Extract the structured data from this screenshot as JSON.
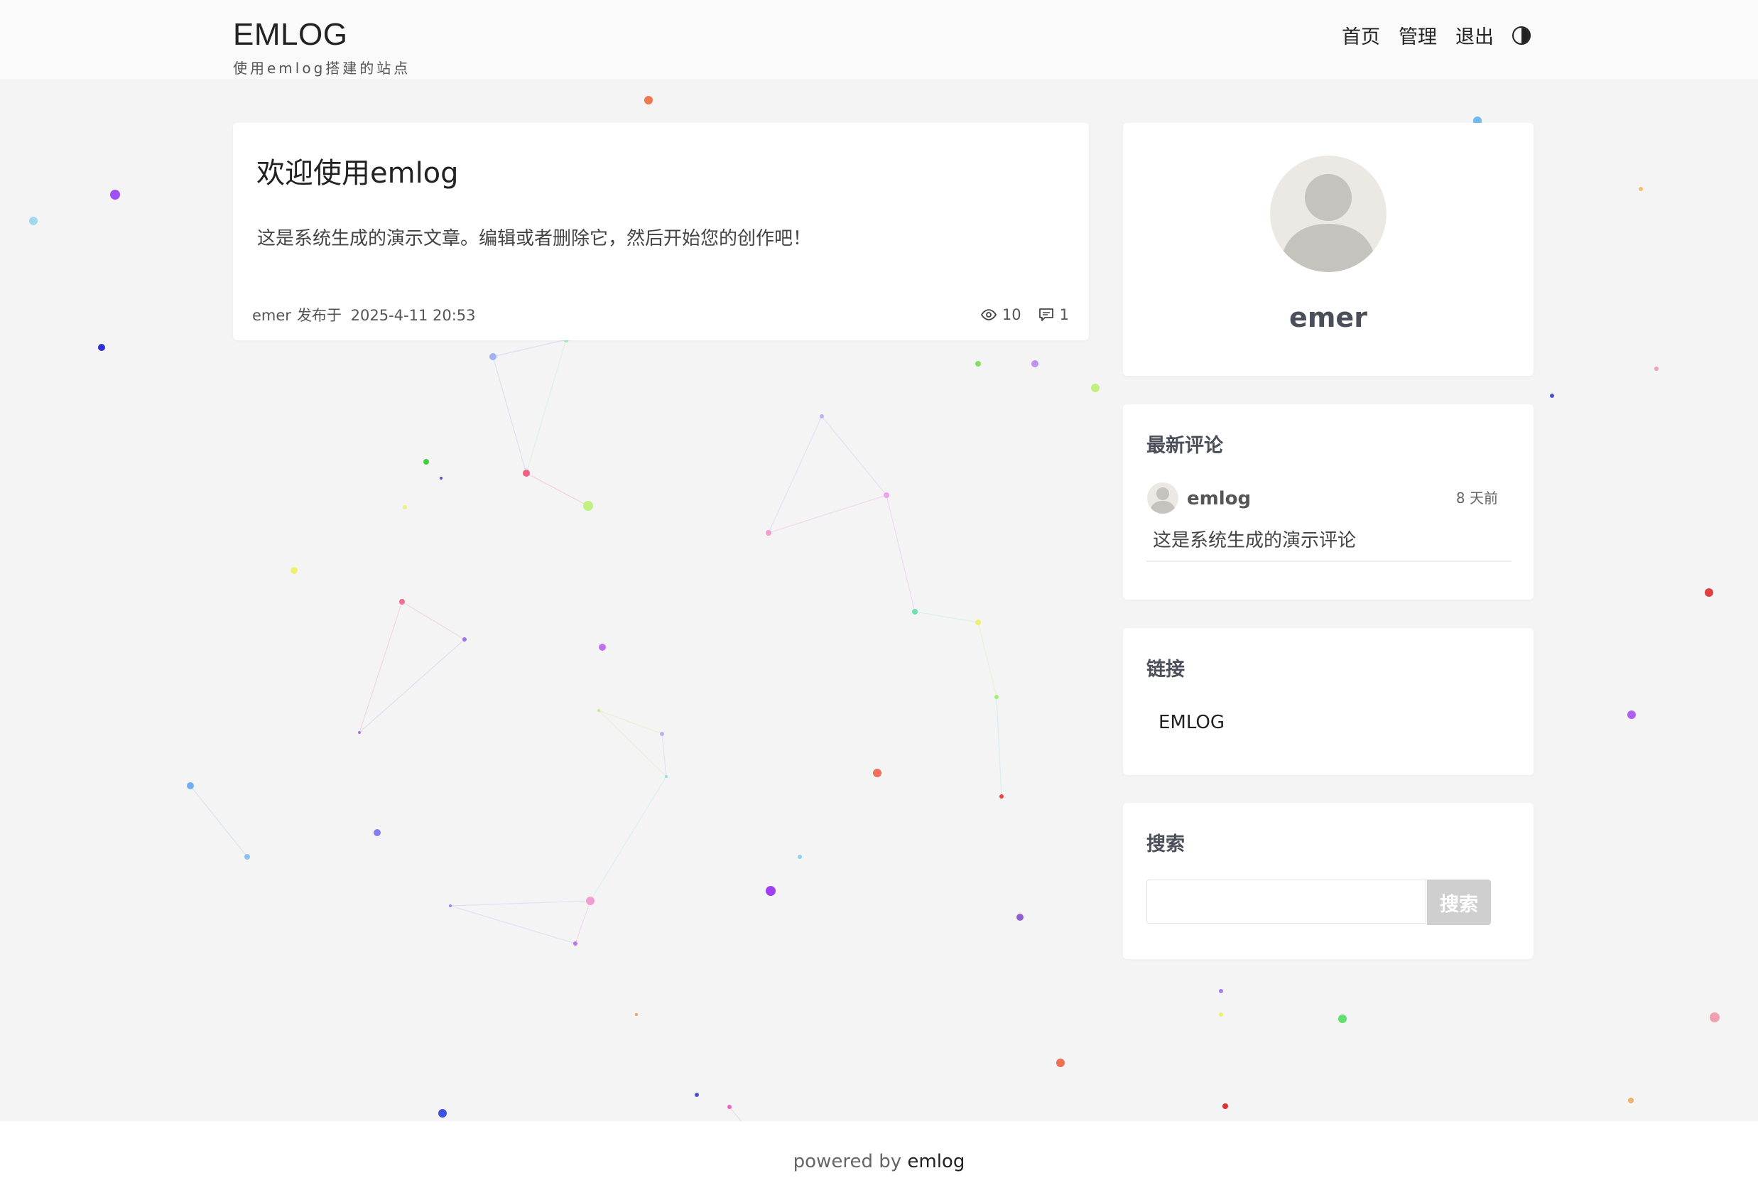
{
  "header": {
    "site_title": "EMLOG",
    "site_subtitle": "使用emlog搭建的站点",
    "nav": [
      {
        "label": "首页"
      },
      {
        "label": "管理"
      },
      {
        "label": "退出"
      }
    ],
    "theme_toggle_icon": "half-circle-icon"
  },
  "post": {
    "title": "欢迎使用emlog",
    "excerpt": "这是系统生成的演示文章。编辑或者删除它，然后开始您的创作吧！",
    "author": "emer",
    "published_label": "发布于",
    "date": "2025-4-11 20:53",
    "views": "10",
    "comments": "1"
  },
  "sidebar": {
    "profile": {
      "name": "emer"
    },
    "latest_comments": {
      "title": "最新评论",
      "items": [
        {
          "author": "emlog",
          "time": "8 天前",
          "text": "这是系统生成的演示评论"
        }
      ]
    },
    "links": {
      "title": "链接",
      "items": [
        {
          "label": "EMLOG"
        }
      ]
    },
    "search": {
      "title": "搜索",
      "placeholder": "",
      "button": "搜索"
    }
  },
  "footer": {
    "prefix": "powered by",
    "link": "emlog"
  },
  "colors": {
    "background": "#f4f4f4",
    "card": "#ffffff",
    "heading": "#4a4f59",
    "search_button": "#cfcfcf"
  }
}
